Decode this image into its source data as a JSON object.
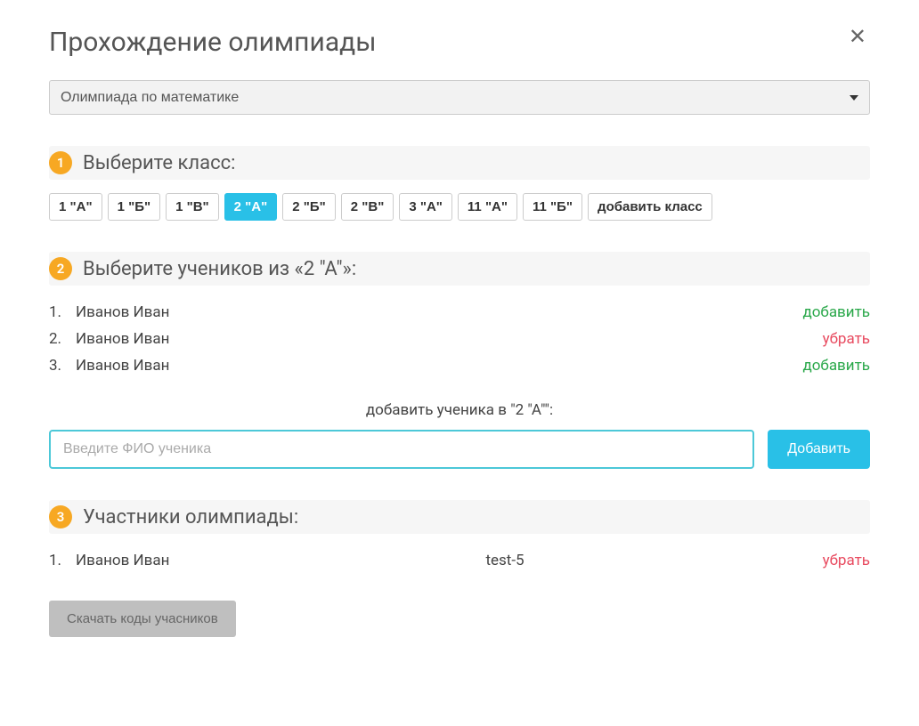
{
  "title": "Прохождение олимпиады",
  "olympiad_selected": "Олимпиада по математике",
  "step1": {
    "number": "1",
    "title": "Выберите класс:"
  },
  "classes": [
    {
      "label": "1 \"А\"",
      "selected": false
    },
    {
      "label": "1 \"Б\"",
      "selected": false
    },
    {
      "label": "1 \"В\"",
      "selected": false
    },
    {
      "label": "2 \"А\"",
      "selected": true
    },
    {
      "label": "2 \"Б\"",
      "selected": false
    },
    {
      "label": "2 \"В\"",
      "selected": false
    },
    {
      "label": "3 \"А\"",
      "selected": false
    },
    {
      "label": "11 \"А\"",
      "selected": false
    },
    {
      "label": "11 \"Б\"",
      "selected": false
    },
    {
      "label": "добавить класс",
      "selected": false
    }
  ],
  "step2": {
    "number": "2",
    "title": "Выберите учеников из «2 \"А\"»:"
  },
  "students": [
    {
      "num": "1.",
      "name": "Иванов Иван",
      "action": "добавить",
      "action_type": "add"
    },
    {
      "num": "2.",
      "name": "Иванов Иван",
      "action": "убрать",
      "action_type": "remove"
    },
    {
      "num": "3.",
      "name": "Иванов Иван",
      "action": "добавить",
      "action_type": "add"
    }
  ],
  "add_student": {
    "label": "добавить ученика в \"2 \"А\"\":",
    "placeholder": "Введите ФИО ученика",
    "button": "Добавить"
  },
  "step3": {
    "number": "3",
    "title": "Участники олимпиады:"
  },
  "participants": [
    {
      "num": "1.",
      "name": "Иванов Иван",
      "code": "test-5",
      "action": "убрать"
    }
  ],
  "download_button": "Скачать коды учасников"
}
